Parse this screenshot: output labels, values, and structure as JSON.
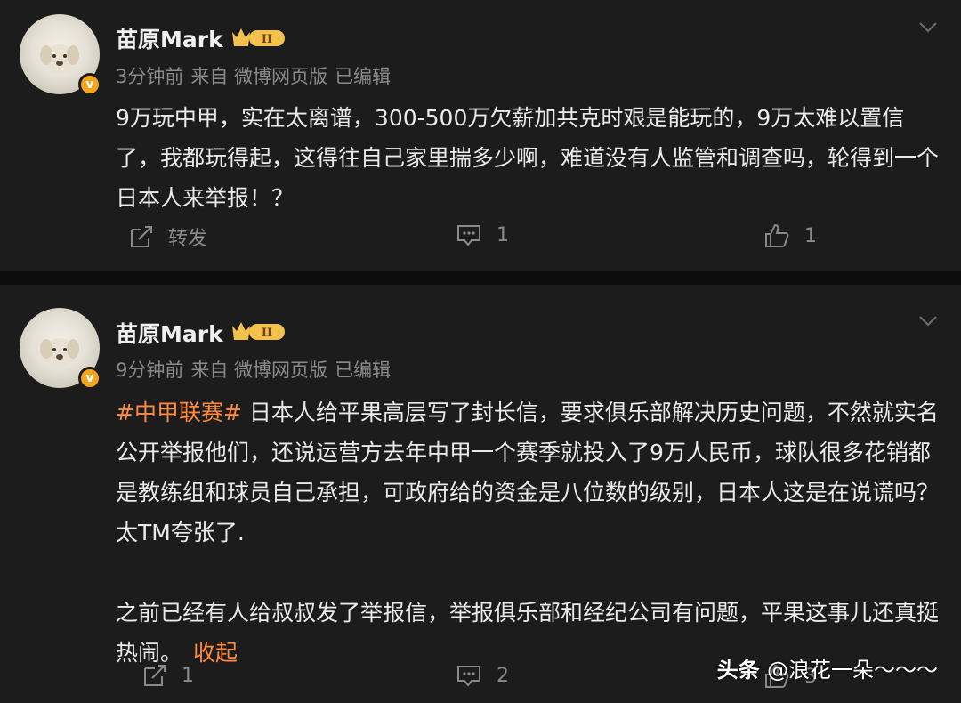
{
  "posts": [
    {
      "user": "苗原Mark",
      "time": "3分钟前",
      "source": "来自 微博网页版",
      "edited": "已编辑",
      "text": "9万玩中甲，实在太离谱，300-500万欠薪加共克时艰是能玩的，9万太难以置信了，我都玩得起，这得往自己家里揣多少啊，难道没有人监管和调查吗，轮得到一个日本人来举报！？",
      "repost_label": "转发",
      "comments": "1",
      "likes": "1"
    },
    {
      "user": "苗原Mark",
      "time": "9分钟前",
      "source": "来自 微博网页版",
      "edited": "已编辑",
      "hashtag": "#中甲联赛#",
      "text": " 日本人给平果高层写了封长信，要求俱乐部解决历史问题，不然就实名公开举报他们，还说运营方去年中甲一个赛季就投入了9万人民币，球队很多花销都是教练组和球员自己承担，可政府给的资金是八位数的级别，日本人这是在说谎吗？太TM夸张了.",
      "text2": "之前已经有人给叔叔发了举报信，举报俱乐部和经纪公司有问题，平果这事儿还真挺热闹。",
      "collapse_label": "收起",
      "reposts": "1",
      "comments": "2",
      "likes": "3"
    }
  ],
  "badge": {
    "level": "II",
    "verified_mark": "v"
  },
  "watermark": {
    "brand": "头条",
    "handle": "@浪花一朵～～～"
  },
  "colors": {
    "accent": "#ff8a3d",
    "badge_gold": "#f2a51d",
    "bg": "#1c1c1c"
  },
  "icons": [
    "avatar-dog-photo",
    "verified-badge-icon",
    "crown-level-icon",
    "chevron-down-icon",
    "repost-icon",
    "comment-icon",
    "like-icon"
  ]
}
